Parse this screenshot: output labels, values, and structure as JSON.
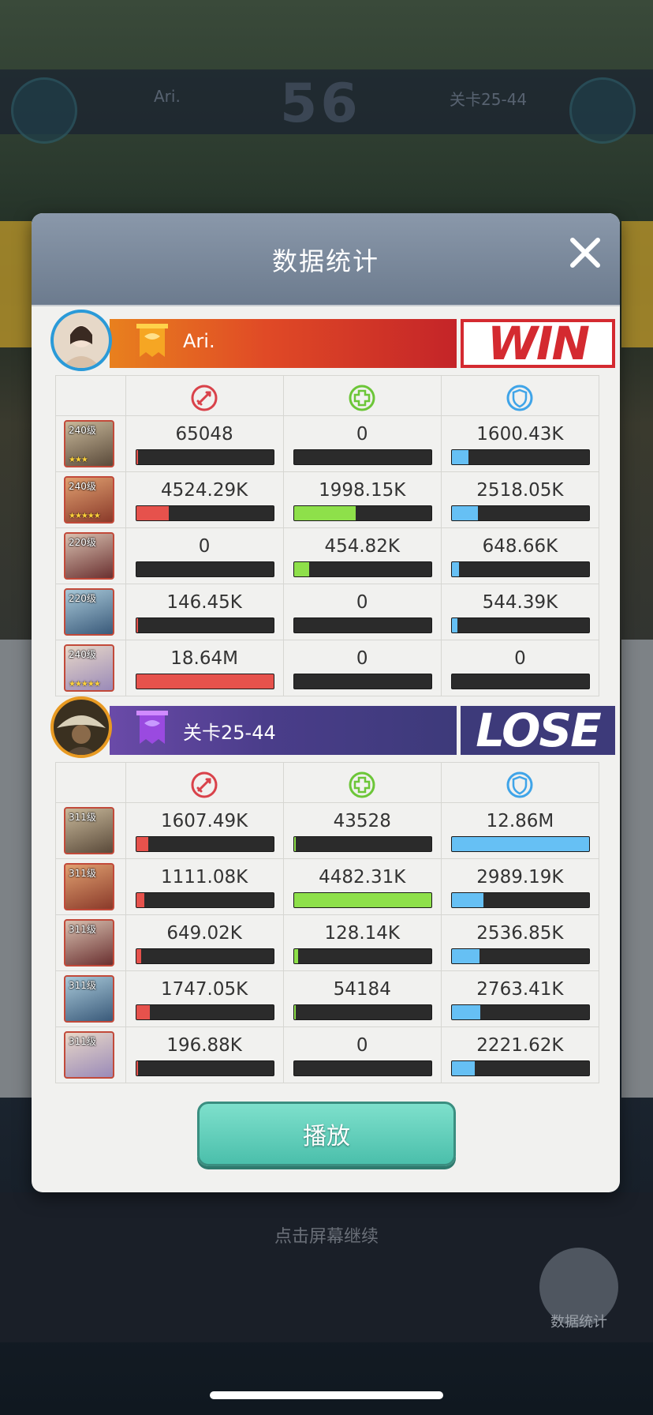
{
  "background": {
    "score": "56",
    "left_name": "Ari.",
    "right_name": "关卡25-44",
    "hint": "点击屏幕继续",
    "stats_button_label": "数据统计"
  },
  "modal": {
    "title": "数据统计"
  },
  "icons": {
    "attack": "sword-icon",
    "heal": "heal-icon",
    "shield": "shield-icon",
    "close": "close-icon"
  },
  "colors": {
    "damage": "#e6524c",
    "heal": "#8ee04a",
    "shield": "#66c0f4",
    "win": "#d42a30",
    "lose": "#3d3a7a"
  },
  "teams": [
    {
      "name": "Ari.",
      "result": "WIN",
      "heroes": [
        {
          "level": "240级",
          "stars": "★★★",
          "damage": "65048",
          "damage_frac": 0.004,
          "heal": "0",
          "heal_frac": 0,
          "shield": "1600.43K",
          "shield_frac": 0.12
        },
        {
          "level": "240级",
          "stars": "★★★★★",
          "damage": "4524.29K",
          "damage_frac": 0.24,
          "heal": "1998.15K",
          "heal_frac": 0.45,
          "shield": "2518.05K",
          "shield_frac": 0.19
        },
        {
          "level": "220级",
          "stars": "",
          "damage": "0",
          "damage_frac": 0,
          "heal": "454.82K",
          "heal_frac": 0.11,
          "shield": "648.66K",
          "shield_frac": 0.05
        },
        {
          "level": "220级",
          "stars": "",
          "damage": "146.45K",
          "damage_frac": 0.01,
          "heal": "0",
          "heal_frac": 0,
          "shield": "544.39K",
          "shield_frac": 0.04
        },
        {
          "level": "240级",
          "stars": "★★★★★",
          "damage": "18.64M",
          "damage_frac": 1.0,
          "heal": "0",
          "heal_frac": 0,
          "shield": "0",
          "shield_frac": 0
        }
      ]
    },
    {
      "name": "关卡25-44",
      "result": "LOSE",
      "heroes": [
        {
          "level": "311级",
          "stars": "",
          "damage": "1607.49K",
          "damage_frac": 0.09,
          "heal": "43528",
          "heal_frac": 0.01,
          "shield": "12.86M",
          "shield_frac": 1.0
        },
        {
          "level": "311级",
          "stars": "",
          "damage": "1111.08K",
          "damage_frac": 0.06,
          "heal": "4482.31K",
          "heal_frac": 1.0,
          "shield": "2989.19K",
          "shield_frac": 0.23
        },
        {
          "level": "311级",
          "stars": "",
          "damage": "649.02K",
          "damage_frac": 0.04,
          "heal": "128.14K",
          "heal_frac": 0.03,
          "shield": "2536.85K",
          "shield_frac": 0.2
        },
        {
          "level": "311级",
          "stars": "",
          "damage": "1747.05K",
          "damage_frac": 0.1,
          "heal": "54184",
          "heal_frac": 0.01,
          "shield": "2763.41K",
          "shield_frac": 0.21
        },
        {
          "level": "311级",
          "stars": "",
          "damage": "196.88K",
          "damage_frac": 0.01,
          "heal": "0",
          "heal_frac": 0,
          "shield": "2221.62K",
          "shield_frac": 0.17
        }
      ]
    }
  ],
  "play_button": "播放"
}
